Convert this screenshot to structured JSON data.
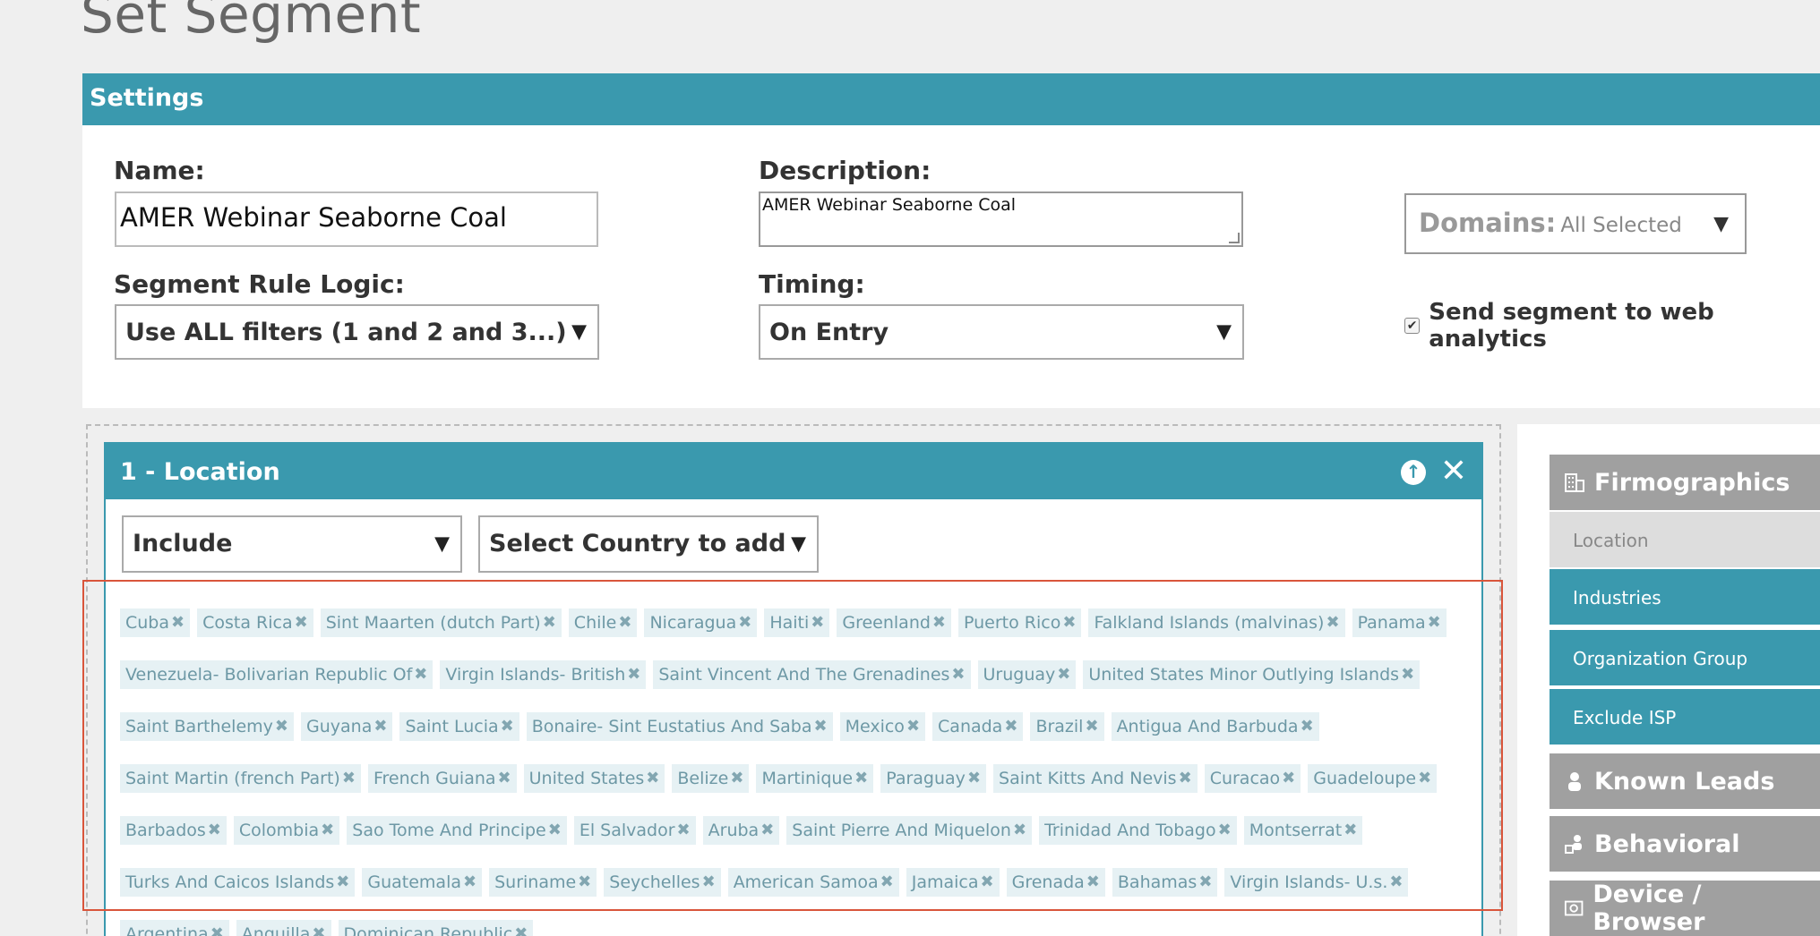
{
  "page_title": "Set Segment",
  "settings": {
    "header": "Settings",
    "name_label": "Name:",
    "name_value": "AMER Webinar Seaborne Coal",
    "description_label": "Description:",
    "description_value": "AMER Webinar Seaborne Coal",
    "domains_label": "Domains:",
    "domains_value": "All Selected",
    "rule_logic_label": "Segment Rule Logic:",
    "rule_logic_value": "Use ALL filters (1 and 2 and 3...)",
    "timing_label": "Timing:",
    "timing_value": "On Entry",
    "send_analytics_label": "Send segment to web analytics",
    "send_analytics_checked": true
  },
  "location_filter": {
    "title": "1 - Location",
    "include_value": "Include",
    "country_select_placeholder": "Select Country to add",
    "countries": [
      "Cuba",
      "Costa Rica",
      "Sint Maarten (dutch Part)",
      "Chile",
      "Nicaragua",
      "Haiti",
      "Greenland",
      "Puerto Rico",
      "Falkland Islands (malvinas)",
      "Panama",
      "Venezuela- Bolivarian Republic Of",
      "Virgin Islands- British",
      "Saint Vincent And The Grenadines",
      "Uruguay",
      "United States Minor Outlying Islands",
      "Saint Barthelemy",
      "Guyana",
      "Saint Lucia",
      "Bonaire- Sint Eustatius And Saba",
      "Mexico",
      "Canada",
      "Brazil",
      "Antigua And Barbuda",
      "Saint Martin (french Part)",
      "French Guiana",
      "United States",
      "Belize",
      "Martinique",
      "Paraguay",
      "Saint Kitts And Nevis",
      "Curacao",
      "Guadeloupe",
      "Barbados",
      "Colombia",
      "Sao Tome And Principe",
      "El Salvador",
      "Aruba",
      "Saint Pierre And Miquelon",
      "Trinidad And Tobago",
      "Montserrat",
      "Turks And Caicos Islands",
      "Guatemala",
      "Suriname",
      "Seychelles",
      "American Samoa",
      "Jamaica",
      "Grenada",
      "Bahamas",
      "Virgin Islands- U.s.",
      "Argentina",
      "Anguilla",
      "Dominican Republic"
    ]
  },
  "sidebar": {
    "firmographics": "Firmographics",
    "items": [
      "Location",
      "Industries",
      "Organization Group",
      "Exclude ISP"
    ],
    "known_leads": "Known Leads",
    "behavioral": "Behavioral",
    "device_browser": "Device / Browser"
  },
  "colors": {
    "teal": "#3a99ae",
    "gray_header": "#a0a0a0",
    "highlight_border": "#d9553b",
    "tag_bg": "#e6f1f4"
  }
}
